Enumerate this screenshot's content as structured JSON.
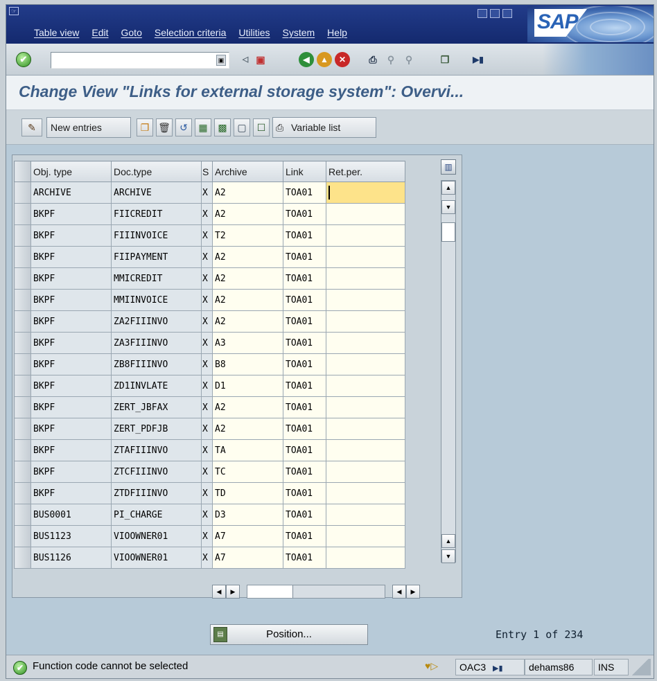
{
  "menu": [
    "Table view",
    "Edit",
    "Goto",
    "Selection criteria",
    "Utilities",
    "System",
    "Help"
  ],
  "logo": "SAP",
  "title": "Change View \"Links for external storage system\": Overvi...",
  "app_toolbar": {
    "new_entries": "New entries",
    "variable_list": "Variable list"
  },
  "table": {
    "columns": [
      "Obj. type",
      "Doc.type",
      "S",
      "Archive",
      "Link",
      "Ret.per."
    ],
    "rows": [
      [
        "ARCHIVE",
        "ARCHIVE",
        "X",
        "A2",
        "TOA01",
        ""
      ],
      [
        "BKPF",
        "FIICREDIT",
        "X",
        "A2",
        "TOA01",
        ""
      ],
      [
        "BKPF",
        "FIIINVOICE",
        "X",
        "T2",
        "TOA01",
        ""
      ],
      [
        "BKPF",
        "FIIPAYMENT",
        "X",
        "A2",
        "TOA01",
        ""
      ],
      [
        "BKPF",
        "MMICREDIT",
        "X",
        "A2",
        "TOA01",
        ""
      ],
      [
        "BKPF",
        "MMIINVOICE",
        "X",
        "A2",
        "TOA01",
        ""
      ],
      [
        "BKPF",
        "ZA2FIIINVO",
        "X",
        "A2",
        "TOA01",
        ""
      ],
      [
        "BKPF",
        "ZA3FIIINVO",
        "X",
        "A3",
        "TOA01",
        ""
      ],
      [
        "BKPF",
        "ZB8FIIINVO",
        "X",
        "B8",
        "TOA01",
        ""
      ],
      [
        "BKPF",
        "ZD1INVLATE",
        "X",
        "D1",
        "TOA01",
        ""
      ],
      [
        "BKPF",
        "ZERT_JBFAX",
        "X",
        "A2",
        "TOA01",
        ""
      ],
      [
        "BKPF",
        "ZERT_PDFJB",
        "X",
        "A2",
        "TOA01",
        ""
      ],
      [
        "BKPF",
        "ZTAFIIINVO",
        "X",
        "TA",
        "TOA01",
        ""
      ],
      [
        "BKPF",
        "ZTCFIIINVO",
        "X",
        "TC",
        "TOA01",
        ""
      ],
      [
        "BKPF",
        "ZTDFIIINVO",
        "X",
        "TD",
        "TOA01",
        ""
      ],
      [
        "BUS0001",
        "PI_CHARGE",
        "X",
        "D3",
        "TOA01",
        ""
      ],
      [
        "BUS1123",
        "VIOOWNER01",
        "X",
        "A7",
        "TOA01",
        ""
      ],
      [
        "BUS1126",
        "VIOOWNER01",
        "X",
        "A7",
        "TOA01",
        ""
      ]
    ]
  },
  "position_button": "Position...",
  "entry_info": "Entry 1 of 234",
  "status": {
    "message": "Function code cannot be selected",
    "transaction": "OAC3",
    "server": "dehams86",
    "mode": "INS"
  }
}
